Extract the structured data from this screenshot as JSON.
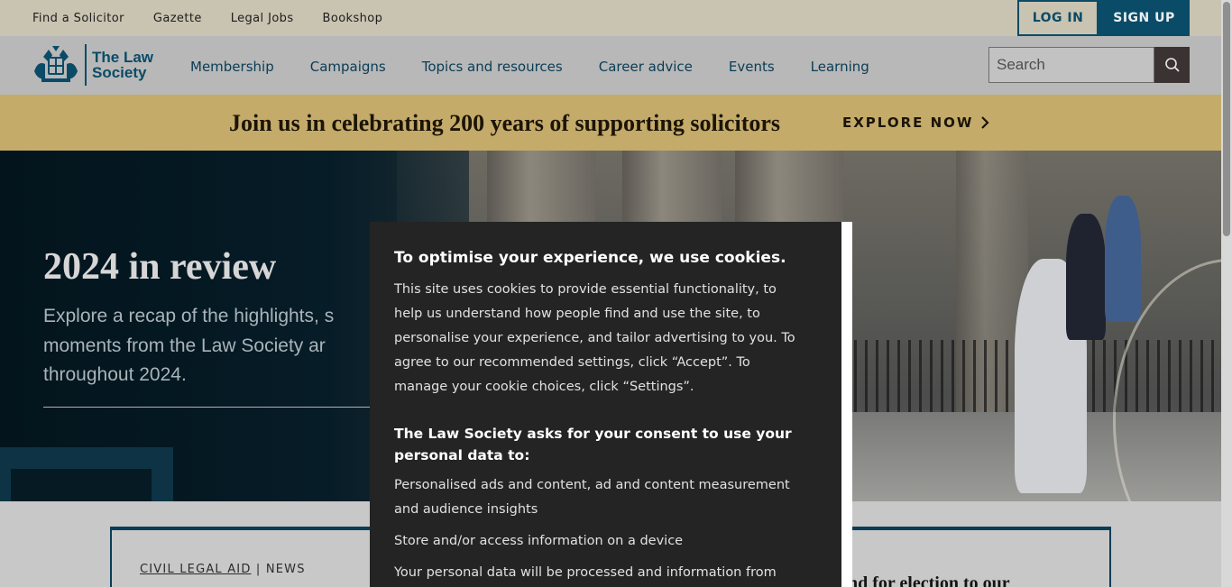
{
  "topbar": {
    "links": [
      "Find a Solicitor",
      "Gazette",
      "Legal Jobs",
      "Bookshop"
    ],
    "login_label": "LOG IN",
    "signup_label": "SIGN UP"
  },
  "header": {
    "logo_line1": "The Law",
    "logo_line2": "Society",
    "nav": [
      "Membership",
      "Campaigns",
      "Topics and resources",
      "Career advice",
      "Events",
      "Learning"
    ],
    "search_placeholder": "Search"
  },
  "promo": {
    "text": "Join us in celebrating 200 years of supporting solicitors",
    "cta": "EXPLORE NOW"
  },
  "hero": {
    "title": "2024 in review",
    "subtitle_line1": "Explore a recap of the highlights, s",
    "subtitle_line2": "moments from the Law Society ar",
    "subtitle_line3": "throughout 2024."
  },
  "cards": {
    "left_tag": "CIVIL LEGAL AID",
    "left_sep": " | ",
    "left_type": "NEWS",
    "right_headline": "nd for election to our"
  },
  "cookie": {
    "title": "To optimise your experience, we use cookies.",
    "body": "This site uses cookies to provide essential functionality, to help us understand how people find and use the site, to personalise your experience, and tailor advertising to you. To agree to our recommended settings, click “Accept”. To manage your cookie choices, click “Settings”.",
    "consent_heading": "The Law Society asks for your consent to use your personal data to:",
    "items": [
      "Personalised ads and content, ad and content measurement and audience insights",
      "Store and/or access information on a device",
      "Your personal data will be processed and information from your"
    ]
  },
  "colors": {
    "brand_teal": "#0a4b67",
    "promo_gold": "#c4ab6a",
    "modal_bg": "#242424"
  }
}
